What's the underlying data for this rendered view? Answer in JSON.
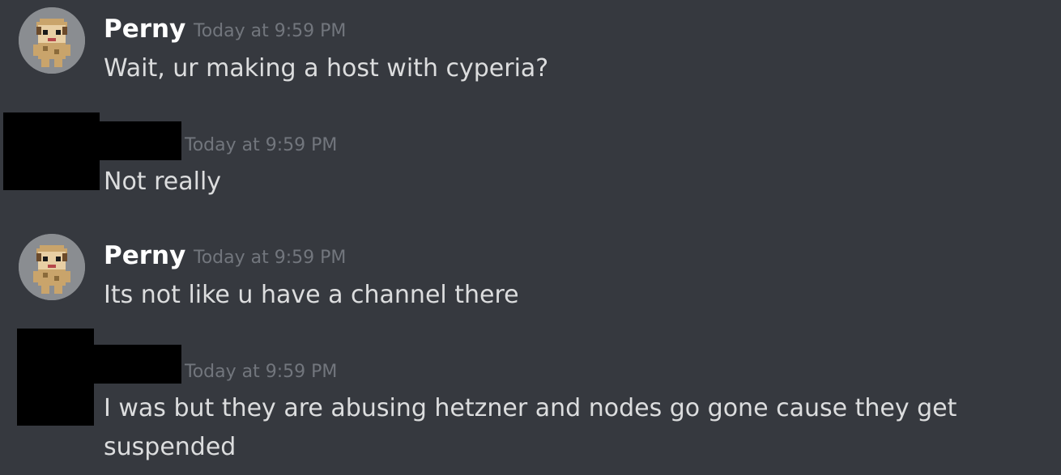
{
  "messages": [
    {
      "author": "Perny",
      "timestamp": "Today at 9:59 PM",
      "text": "Wait, ur making a host with cyperia?",
      "avatar_icon": "pixel-character-avatar"
    },
    {
      "author": "",
      "timestamp": "Today at 9:59 PM",
      "text": "Not really",
      "redacted": true
    },
    {
      "author": "Perny",
      "timestamp": "Today at 9:59 PM",
      "text": "Its not like u have a channel there",
      "avatar_icon": "pixel-character-avatar"
    },
    {
      "author": "",
      "timestamp": "Today at 9:59 PM",
      "text": "I was but they are abusing hetzner and nodes go gone cause they get suspended",
      "redacted": true
    }
  ],
  "colors": {
    "background": "#36393f",
    "username": "#ffffff",
    "timestamp": "#72767d",
    "message_text": "#dcddde",
    "redaction": "#000000"
  }
}
